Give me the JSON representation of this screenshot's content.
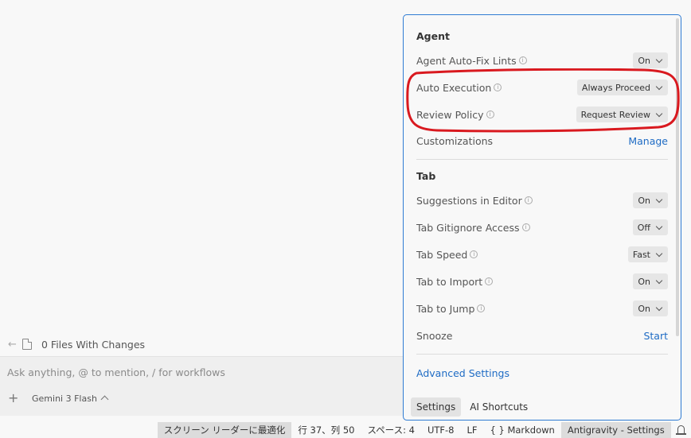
{
  "agent_pane": {
    "files_changes": "0 Files With Changes",
    "chat_placeholder": "Ask anything, @ to mention, / for workflows",
    "model": "Gemini 3 Flash"
  },
  "settings": {
    "agent_title": "Agent",
    "agent_rows": {
      "autofix": {
        "label": "Agent Auto-Fix Lints",
        "value": "On"
      },
      "auto_exec": {
        "label": "Auto Execution",
        "value": "Always Proceed"
      },
      "review": {
        "label": "Review Policy",
        "value": "Request Review"
      },
      "custom": {
        "label": "Customizations",
        "link": "Manage"
      }
    },
    "tab_title": "Tab",
    "tab_rows": {
      "suggestions": {
        "label": "Suggestions in Editor",
        "value": "On"
      },
      "gitignore": {
        "label": "Tab Gitignore Access",
        "value": "Off"
      },
      "speed": {
        "label": "Tab Speed",
        "value": "Fast"
      },
      "import": {
        "label": "Tab to Import",
        "value": "On"
      },
      "jump": {
        "label": "Tab to Jump",
        "value": "On"
      },
      "snooze": {
        "label": "Snooze",
        "link": "Start"
      }
    },
    "advanced": "Advanced Settings",
    "tabs": {
      "settings": "Settings",
      "shortcuts": "AI Shortcuts"
    }
  },
  "statusbar": {
    "screen_reader": "スクリーン リーダーに最適化",
    "position": "行 37、列 50",
    "spaces": "スペース: 4",
    "encoding": "UTF-8",
    "eol": "LF",
    "language": "{ } Markdown",
    "app": "Antigravity - Settings"
  },
  "colors": {
    "accent": "#2f7bd3",
    "link": "#1e6bc4",
    "highlight": "#d9191f"
  }
}
